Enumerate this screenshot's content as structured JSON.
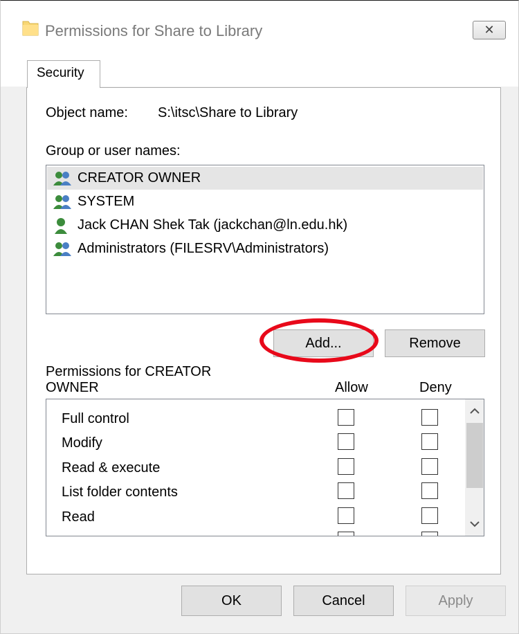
{
  "window": {
    "title": "Permissions for Share to Library",
    "close_glyph": "✕"
  },
  "tabs": [
    {
      "label": "Security",
      "active": true
    }
  ],
  "object": {
    "label": "Object name:",
    "value": "S:\\itsc\\Share to Library"
  },
  "group_label": "Group or user names:",
  "principals": [
    {
      "name": "CREATOR OWNER",
      "icon": "users-group-icon",
      "selected": true
    },
    {
      "name": "SYSTEM",
      "icon": "users-group-icon",
      "selected": false
    },
    {
      "name": "Jack CHAN Shek Tak (jackchan@ln.edu.hk)",
      "icon": "user-icon",
      "selected": false
    },
    {
      "name": "Administrators (FILESRV\\Administrators)",
      "icon": "users-group-icon",
      "selected": false
    }
  ],
  "buttons": {
    "add": "Add...",
    "remove": "Remove",
    "ok": "OK",
    "cancel": "Cancel",
    "apply": "Apply"
  },
  "permissions": {
    "label_line1": "Permissions for CREATOR",
    "label_line2": "OWNER",
    "allow_header": "Allow",
    "deny_header": "Deny",
    "items": [
      {
        "name": "Full control",
        "allow": false,
        "deny": false
      },
      {
        "name": "Modify",
        "allow": false,
        "deny": false
      },
      {
        "name": "Read & execute",
        "allow": false,
        "deny": false
      },
      {
        "name": "List folder contents",
        "allow": false,
        "deny": false
      },
      {
        "name": "Read",
        "allow": false,
        "deny": false
      }
    ]
  },
  "colors": {
    "annotation_ring": "#e8091a",
    "selection": "#e5e5e5"
  }
}
